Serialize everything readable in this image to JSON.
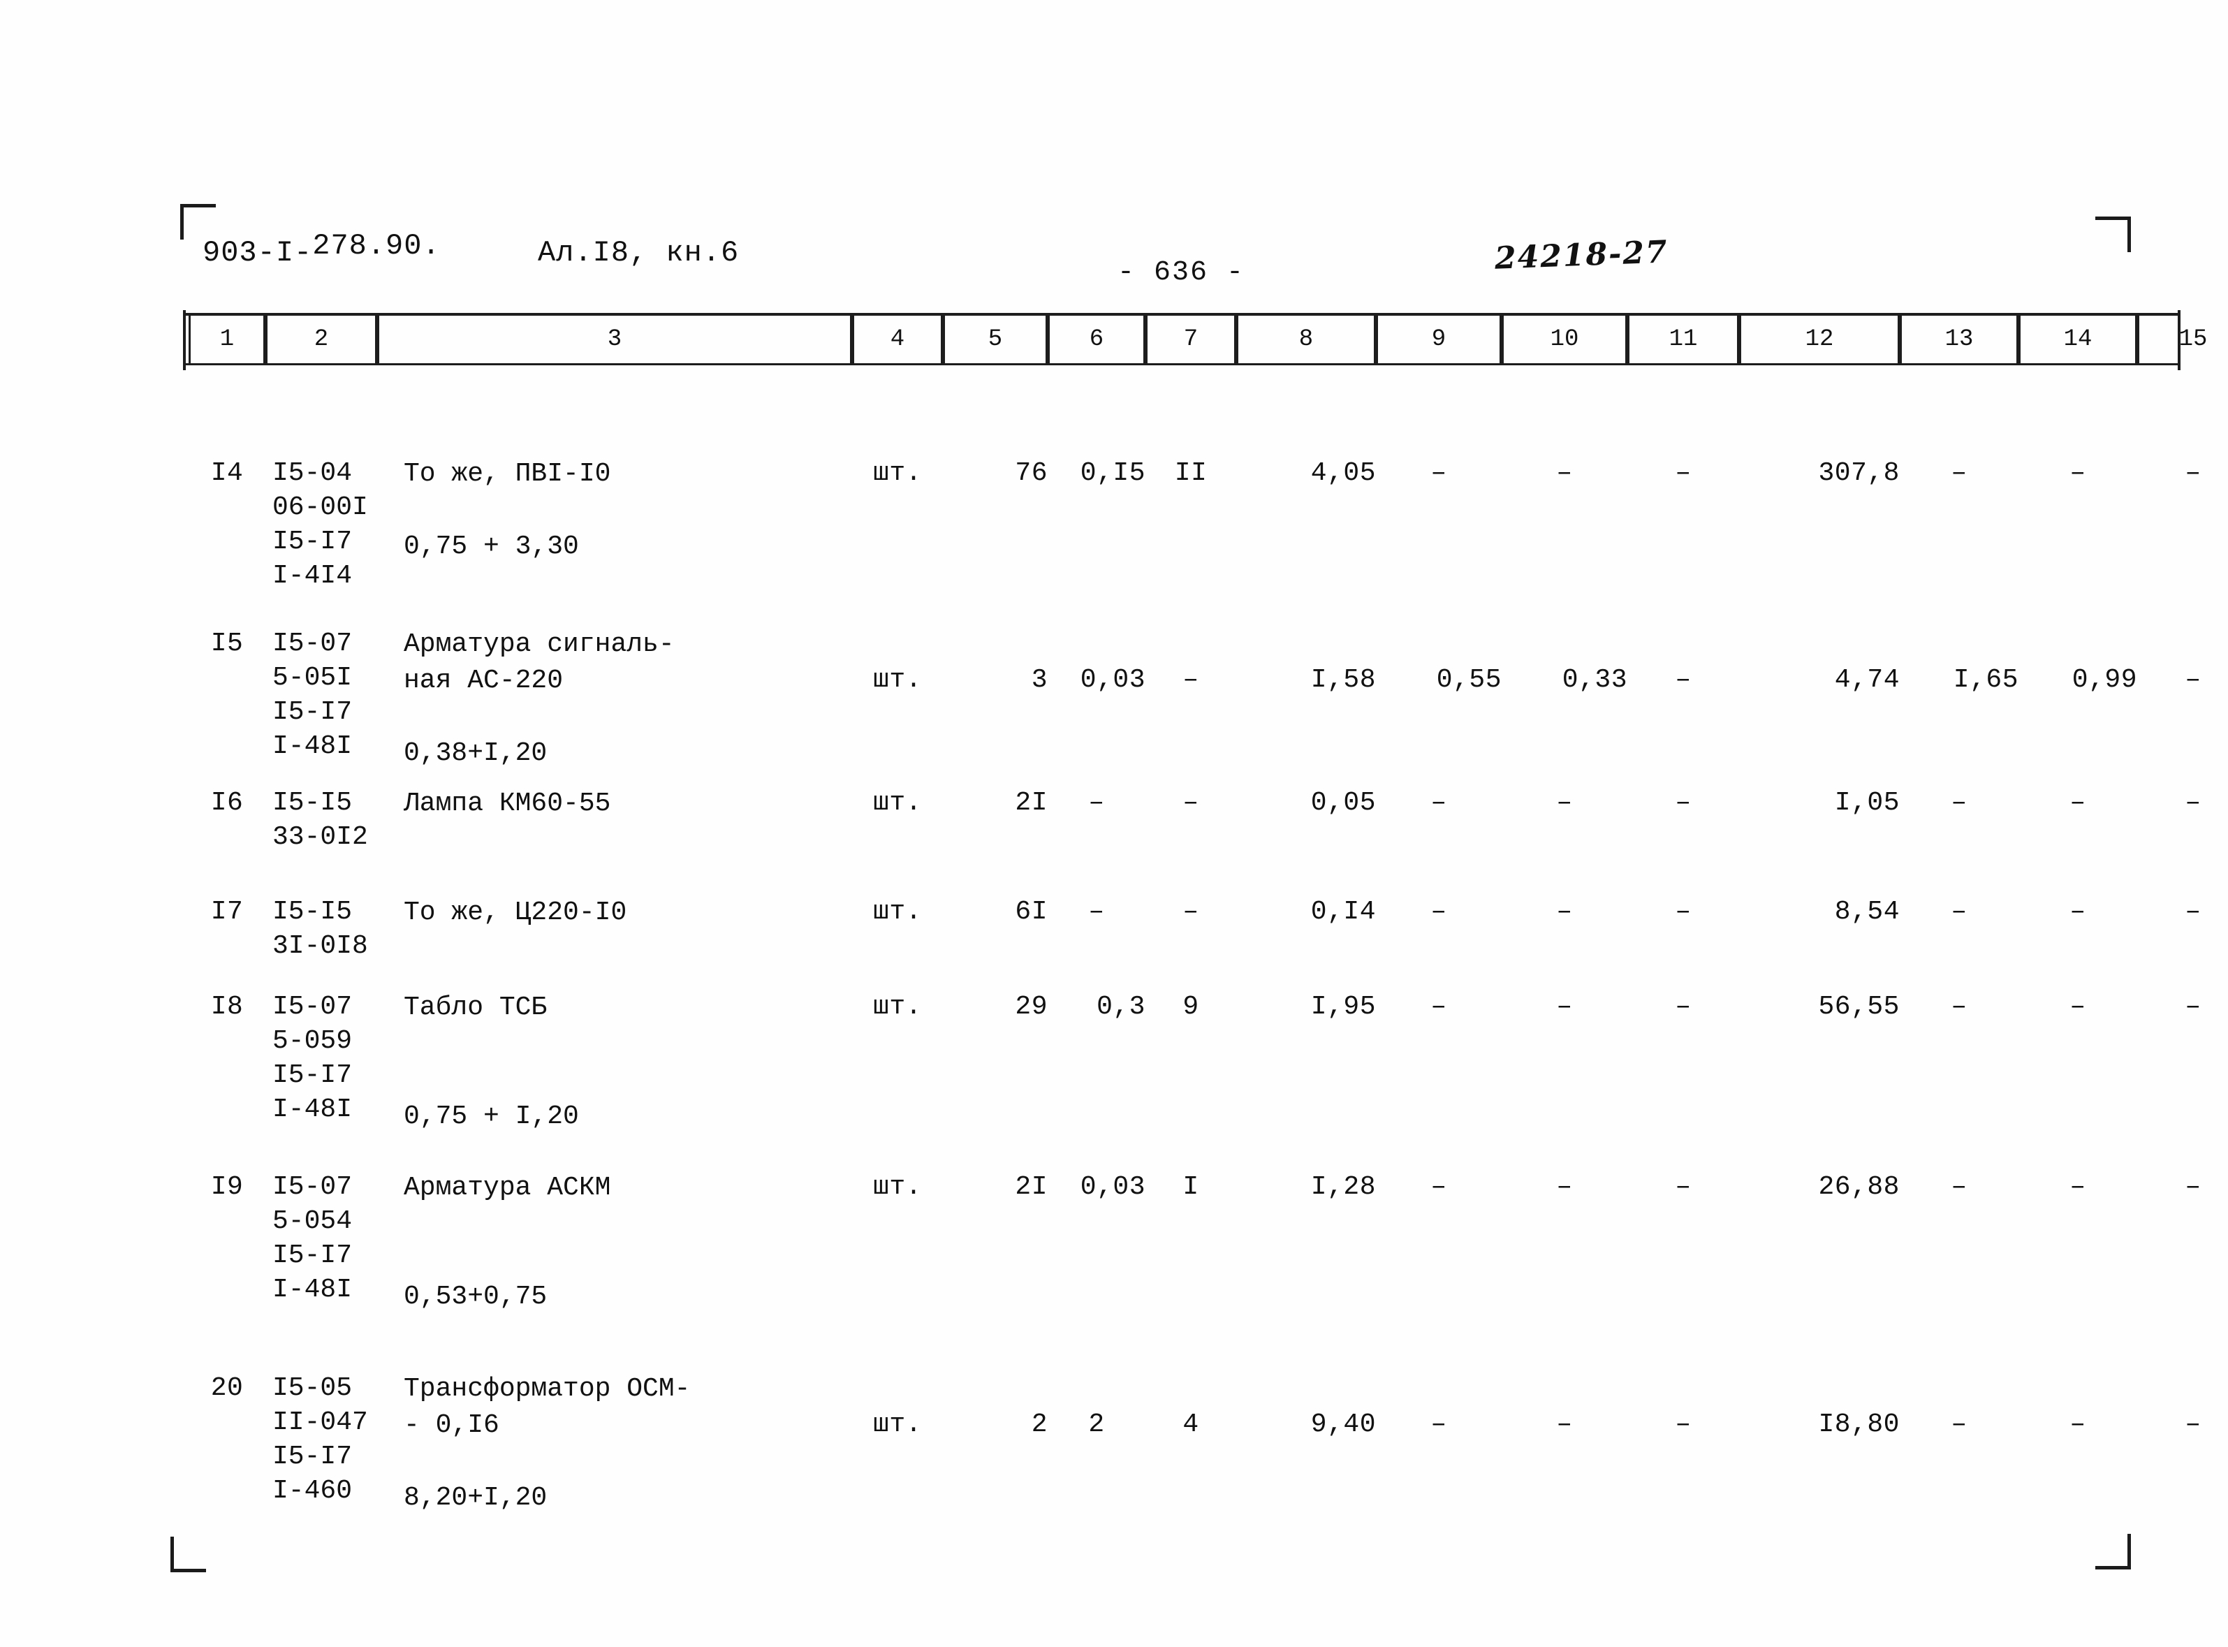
{
  "header": {
    "doc_code_main": "903-I-",
    "doc_code_sub": "278.90.",
    "album": "Ал.I8, кн.6",
    "page_number": "- 636 -",
    "stamp": "24218-27"
  },
  "table": {
    "column_headers": [
      "1",
      "2",
      "3",
      "4",
      "5",
      "6",
      "7",
      "8",
      "9",
      "10",
      "11",
      "12",
      "13",
      "14",
      "15"
    ],
    "rows": [
      {
        "c1": "I4",
        "code_lines": [
          "I5-04",
          "06-00I",
          "I5-I7",
          "I-4I4"
        ],
        "desc_lines": [
          "То же, ПВI-I0",
          "0,75 + 3,30"
        ],
        "c4": "шт.",
        "c5": "76",
        "c6": "0,I5",
        "c7": "II",
        "c8": "4,05",
        "c9": "–",
        "c10": "–",
        "c11": "–",
        "c12": "307,8",
        "c13": "–",
        "c14": "–",
        "c15": "–"
      },
      {
        "c1": "I5",
        "code_lines": [
          "I5-07",
          "5-05I",
          "I5-I7",
          "I-48I"
        ],
        "desc_lines": [
          "Арматура сигналь-",
          "ная АС-220",
          "0,38+I,20"
        ],
        "c4": "шт.",
        "c5": "3",
        "c6": "0,03",
        "c7": "–",
        "c8": "I,58",
        "c9": "0,55",
        "c10": "0,33",
        "c11": "–",
        "c12": "4,74",
        "c13": "I,65",
        "c14": "0,99",
        "c15": "–"
      },
      {
        "c1": "I6",
        "code_lines": [
          "I5-I5",
          "33-0I2"
        ],
        "desc_lines": [
          "Лампа КМ60-55"
        ],
        "c4": "шт.",
        "c5": "2I",
        "c6": "–",
        "c7": "–",
        "c8": "0,05",
        "c9": "–",
        "c10": "–",
        "c11": "–",
        "c12": "I,05",
        "c13": "–",
        "c14": "–",
        "c15": "–"
      },
      {
        "c1": "I7",
        "code_lines": [
          "I5-I5",
          "3I-0I8"
        ],
        "desc_lines": [
          "То же, Ц220-I0"
        ],
        "c4": "шт.",
        "c5": "6I",
        "c6": "–",
        "c7": "–",
        "c8": "0,I4",
        "c9": "–",
        "c10": "–",
        "c11": "–",
        "c12": "8,54",
        "c13": "–",
        "c14": "–",
        "c15": "–"
      },
      {
        "c1": "I8",
        "code_lines": [
          "I5-07",
          "5-059",
          "I5-I7",
          "I-48I"
        ],
        "desc_lines": [
          "Табло ТСБ",
          "0,75 + I,20"
        ],
        "c4": "шт.",
        "c5": "29",
        "c6": "0,3",
        "c7": "9",
        "c8": "I,95",
        "c9": "–",
        "c10": "–",
        "c11": "–",
        "c12": "56,55",
        "c13": "–",
        "c14": "–",
        "c15": "–"
      },
      {
        "c1": "I9",
        "code_lines": [
          "I5-07",
          "5-054",
          "I5-I7",
          "I-48I"
        ],
        "desc_lines": [
          "Арматура АСКМ",
          "0,53+0,75"
        ],
        "c4": "шт.",
        "c5": "2I",
        "c6": "0,03",
        "c7": "I",
        "c8": "I,28",
        "c9": "–",
        "c10": "–",
        "c11": "–",
        "c12": "26,88",
        "c13": "–",
        "c14": "–",
        "c15": "–"
      },
      {
        "c1": "20",
        "code_lines": [
          "I5-05",
          "II-047",
          "I5-I7",
          "I-460"
        ],
        "desc_lines": [
          "Трансформатор ОСМ-",
          "- 0,I6",
          "8,20+I,20"
        ],
        "c4": "шт.",
        "c5": "2",
        "c6": "2",
        "c7": "4",
        "c8": "9,40",
        "c9": "–",
        "c10": "–",
        "c11": "–",
        "c12": "I8,80",
        "c13": "–",
        "c14": "–",
        "c15": "–"
      }
    ]
  }
}
